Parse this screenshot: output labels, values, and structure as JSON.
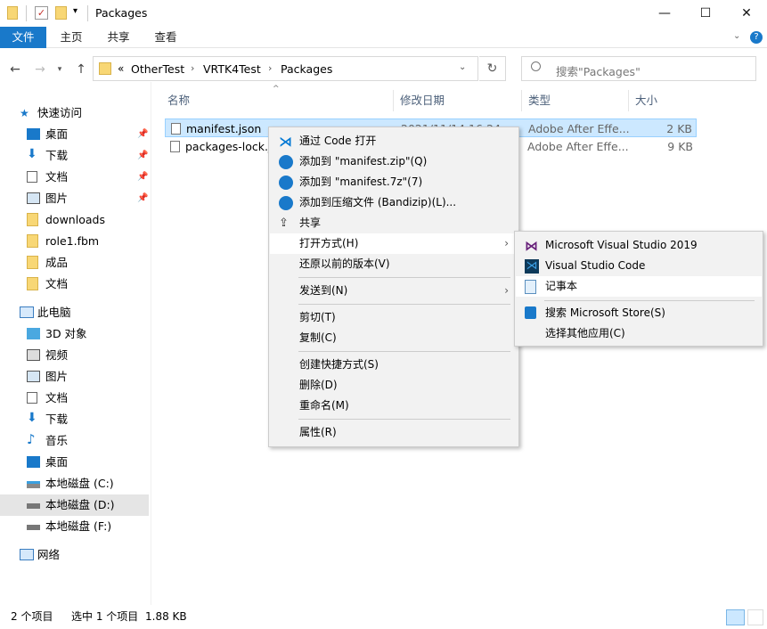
{
  "window": {
    "title": "Packages",
    "controls": {
      "minimize": "—",
      "maximize": "☐",
      "close": "✕"
    }
  },
  "ribbon": {
    "tabs": [
      "文件",
      "主页",
      "共享",
      "查看"
    ]
  },
  "address": {
    "crumbs": [
      "«",
      "OtherTest",
      "VRTK4Test",
      "Packages"
    ],
    "search_placeholder": "搜索\"Packages\""
  },
  "sidebar": {
    "quick_access": "快速访问",
    "quick_items": [
      "桌面",
      "下载",
      "文档",
      "图片",
      "downloads",
      "role1.fbm",
      "成品",
      "文档"
    ],
    "this_pc": "此电脑",
    "pc_items": [
      "3D 对象",
      "视频",
      "图片",
      "文档",
      "下载",
      "音乐",
      "桌面",
      "本地磁盘 (C:)",
      "本地磁盘 (D:)",
      "本地磁盘 (F:)"
    ],
    "network": "网络"
  },
  "columns": {
    "name": "名称",
    "date": "修改日期",
    "type": "类型",
    "size": "大小"
  },
  "files": [
    {
      "name": "manifest.json",
      "date": "2021/11/14 16:24",
      "type": "Adobe After Effe...",
      "size": "2 KB"
    },
    {
      "name": "packages-lock.j",
      "date": "",
      "type": "Adobe After Effe...",
      "size": "9 KB"
    }
  ],
  "context_menu": {
    "items": [
      "通过 Code 打开",
      "添加到 \"manifest.zip\"(Q)",
      "添加到 \"manifest.7z\"(7)",
      "添加到压缩文件 (Bandizip)(L)...",
      "共享",
      "打开方式(H)",
      "还原以前的版本(V)",
      "发送到(N)",
      "剪切(T)",
      "复制(C)",
      "创建快捷方式(S)",
      "删除(D)",
      "重命名(M)",
      "属性(R)"
    ]
  },
  "submenu": {
    "items": [
      "Microsoft Visual Studio 2019",
      "Visual Studio Code",
      "记事本",
      "搜索 Microsoft Store(S)",
      "选择其他应用(C)"
    ]
  },
  "status": {
    "count": "2 个项目",
    "selection": "选中 1 个项目",
    "size": "1.88 KB"
  },
  "colors": {
    "accent": "#1979ca",
    "selection": "#cce8ff",
    "folder": "#f8d775",
    "vscode": "#0078d4",
    "vs": "#68217a"
  }
}
